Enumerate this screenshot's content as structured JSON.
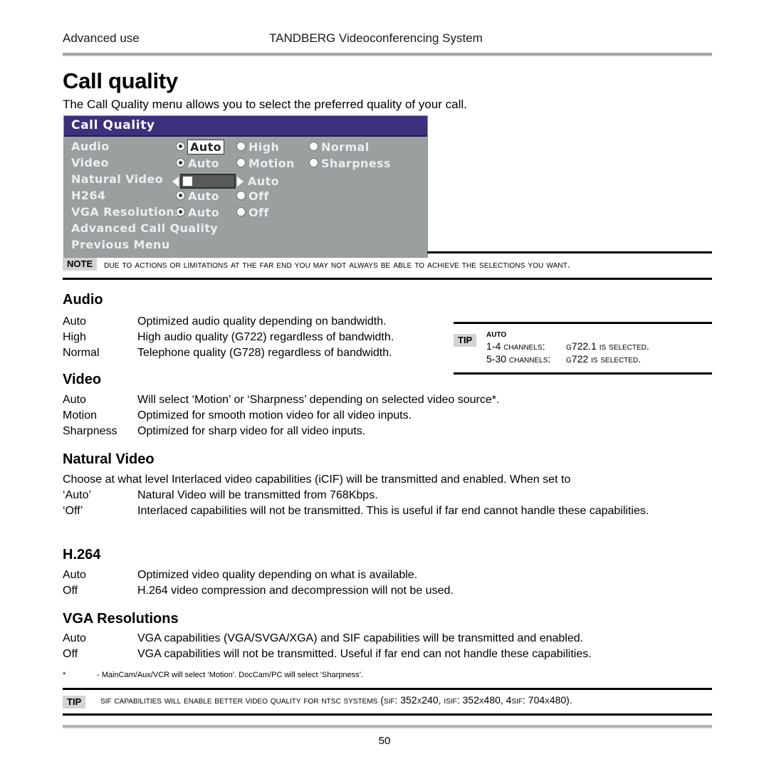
{
  "running_head": {
    "left": "Advanced use",
    "center": "TANDBERG Videoconferencing System"
  },
  "title": "Call quality",
  "intro": "The Call Quality menu allows you to select the preferred quality of your call.",
  "osd": {
    "title": "Call Quality",
    "rows": [
      {
        "label": "Audio",
        "type": "radio",
        "options": [
          {
            "text": "Auto",
            "selected": true,
            "highlighted": true
          },
          {
            "text": "High",
            "selected": false,
            "highlighted": false
          },
          {
            "text": "Normal",
            "selected": false,
            "highlighted": false
          }
        ]
      },
      {
        "label": "Video",
        "type": "radio",
        "options": [
          {
            "text": "Auto",
            "selected": true,
            "highlighted": false
          },
          {
            "text": "Motion",
            "selected": false,
            "highlighted": false
          },
          {
            "text": "Sharpness",
            "selected": false,
            "highlighted": false
          }
        ]
      },
      {
        "label": "Natural Video",
        "type": "slider",
        "value": "Auto"
      },
      {
        "label": "H264",
        "type": "radio",
        "options": [
          {
            "text": "Auto",
            "selected": true,
            "highlighted": false
          },
          {
            "text": "Off",
            "selected": false,
            "highlighted": false
          }
        ]
      },
      {
        "label": "VGA Resolutions",
        "type": "radio",
        "options": [
          {
            "text": "Auto",
            "selected": true,
            "highlighted": false
          },
          {
            "text": "Off",
            "selected": false,
            "highlighted": false
          }
        ]
      },
      {
        "label": "Advanced Call Quality",
        "type": "menu"
      },
      {
        "label": "Previous Menu",
        "type": "menu"
      }
    ]
  },
  "note": {
    "tag": "NOTE",
    "text": "Due to actions or limitations at the far end you may not always be able to achieve the selections you want."
  },
  "sections": {
    "audio": {
      "heading": "Audio",
      "rows": [
        {
          "term": "Auto",
          "desc": "Optimized audio quality depending on bandwidth."
        },
        {
          "term": "High",
          "desc": "High audio quality (G722) regardless of bandwidth."
        },
        {
          "term": "Normal",
          "desc": "Telephone quality (G728) regardless of bandwidth."
        }
      ]
    },
    "video": {
      "heading": "Video",
      "rows": [
        {
          "term": "Auto",
          "desc": "Will select ‘Motion’ or ‘Sharpness’ depending on selected video source*."
        },
        {
          "term": "Motion",
          "desc": "Optimized for smooth motion video for all video inputs."
        },
        {
          "term": "Sharpness",
          "desc": "Optimized for sharp video for all video inputs."
        }
      ]
    },
    "natural_video": {
      "heading": "Natural Video",
      "intro": "Choose at what level Interlaced video capabilities (iCIF) will be transmitted and enabled. When set to",
      "rows": [
        {
          "term": "‘Auto’",
          "desc": "Natural Video will be transmitted from 768Kbps."
        },
        {
          "term": "‘Off’",
          "desc": "Interlaced capabilities will not be transmitted. This is useful if far end cannot handle these capabilities."
        }
      ]
    },
    "h264": {
      "heading": "H.264",
      "rows": [
        {
          "term": "Auto",
          "desc": "Optimized video quality depending on what is available."
        },
        {
          "term": "Off",
          "desc": "H.264 video compression and decompression will not be used."
        }
      ]
    },
    "vga": {
      "heading": "VGA Resolutions",
      "rows": [
        {
          "term": "Auto",
          "desc": "VGA capabilities (VGA/SVGA/XGA) and SIF capabilities will be transmitted and enabled."
        },
        {
          "term": "Off",
          "desc": "VGA capabilities will not be transmitted. Useful if far end can not handle these capabilities."
        }
      ]
    }
  },
  "tip_audio": {
    "tag": "TIP",
    "heading": "Auto",
    "rows": [
      {
        "label": "1-4 channels:",
        "value": "G722.1 is selected."
      },
      {
        "label": "5-30 channels:",
        "value": "G722 is selected."
      }
    ]
  },
  "footnote": {
    "marker": "*",
    "text": "- MainCam/Aux/VCR will select ‘Motion’. DocCam/PC will select ‘Sharpness’."
  },
  "tip_bottom": {
    "tag": "TIP",
    "text": "SIF capabilities will enable better video quality for NTSC systems (SIF: 352x240, ISIF: 352x480, 4SIF: 704x480)."
  },
  "page_number": "50",
  "colors": {
    "osd_title_bar": "#3d2f7d",
    "osd_background": "#9a9fa0",
    "osd_text": "#e9eef2",
    "callout_tag_bg": "#d3d3d3",
    "rule": "#000000"
  }
}
